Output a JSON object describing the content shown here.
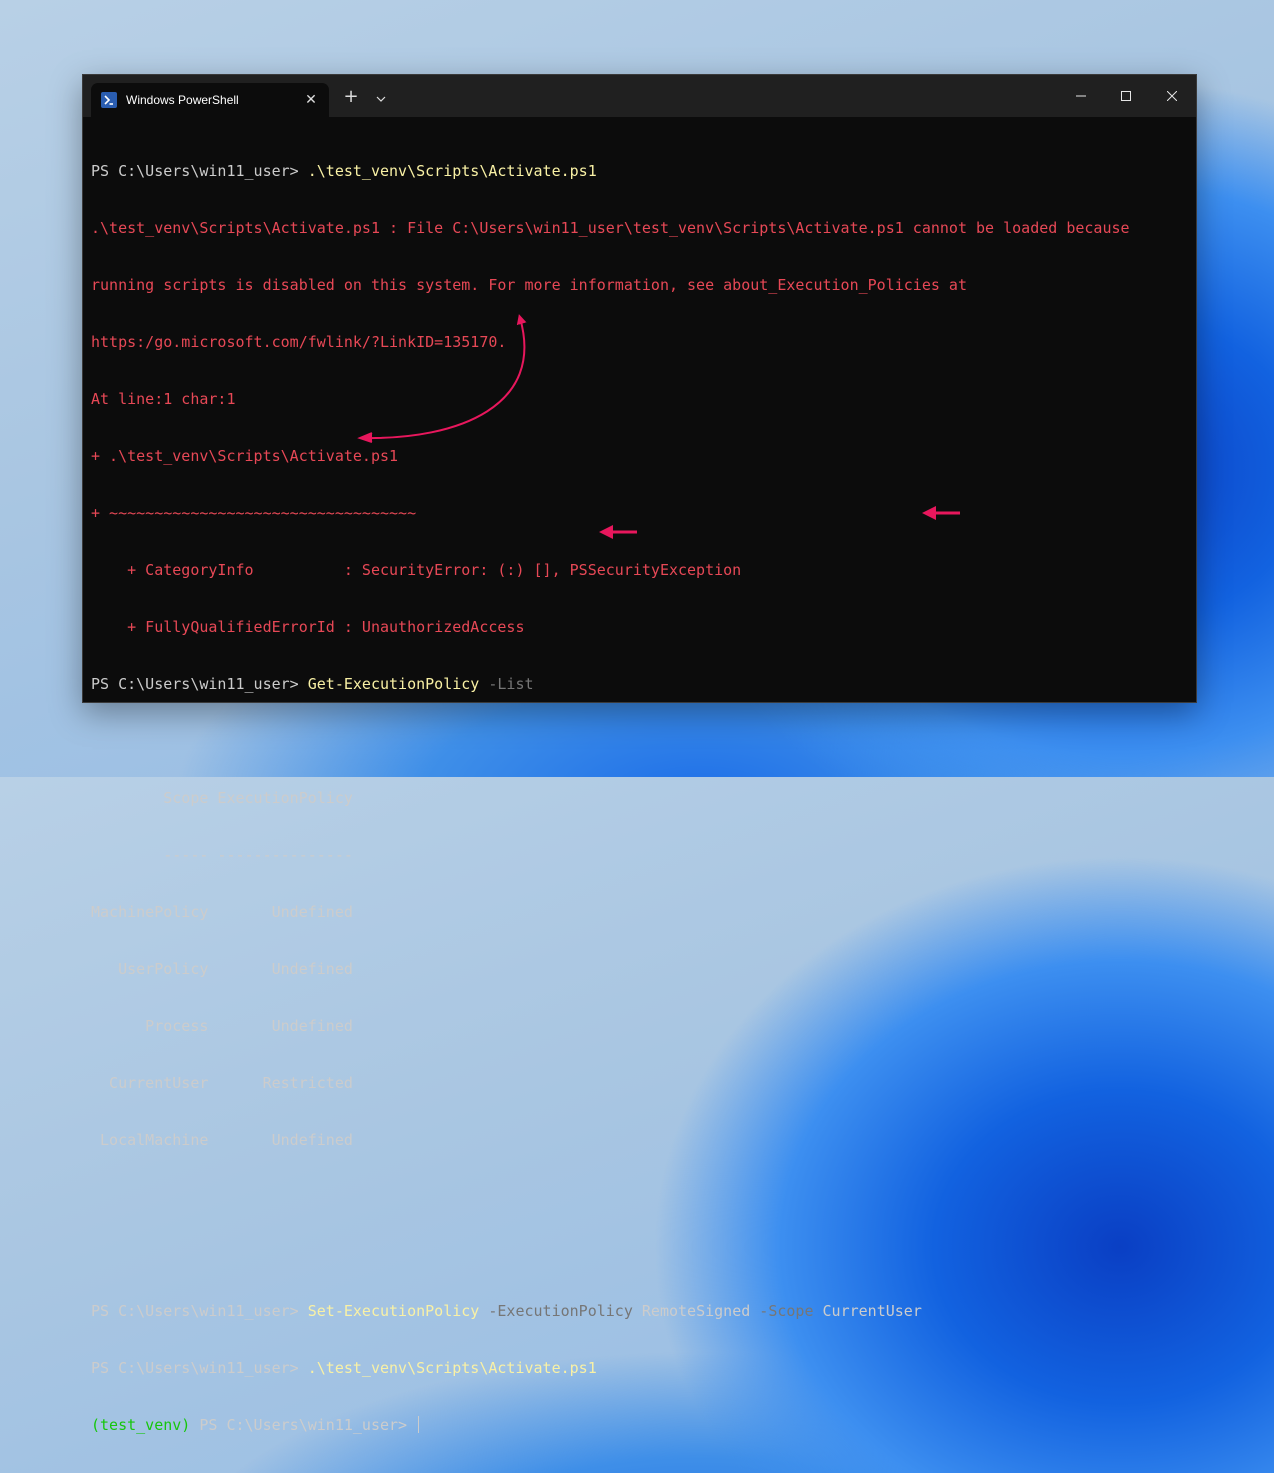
{
  "window": {
    "tab_title": "Windows PowerShell",
    "tab_close_glyph": "✕",
    "new_tab_glyph": "+",
    "dropdown_glyph": "⌄"
  },
  "terminal": {
    "prompt": "PS C:\\Users\\win11_user> ",
    "venv_prefix": "(test_venv)",
    "venv_prompt": " PS C:\\Users\\win11_user> ",
    "cmd_activate": ".\\test_venv\\Scripts\\Activate.ps1",
    "error_lines": [
      ".\\test_venv\\Scripts\\Activate.ps1 : File C:\\Users\\win11_user\\test_venv\\Scripts\\Activate.ps1 cannot be loaded because",
      "running scripts is disabled on this system. For more information, see about_Execution_Policies at",
      "https:/go.microsoft.com/fwlink/?LinkID=135170.",
      "At line:1 char:1",
      "+ .\\test_venv\\Scripts\\Activate.ps1",
      "+ ~~~~~~~~~~~~~~~~~~~~~~~~~~~~~~~~~~",
      "    + CategoryInfo          : SecurityError: (:) [], PSSecurityException",
      "    + FullyQualifiedErrorId : UnauthorizedAccess"
    ],
    "cmd_get": "Get-ExecutionPolicy",
    "cmd_get_param": " -List",
    "table_header": "        Scope ExecutionPolicy",
    "table_divider": "        ----- ---------------",
    "table_rows": [
      "MachinePolicy       Undefined",
      "   UserPolicy       Undefined",
      "      Process       Undefined",
      "  CurrentUser      Restricted",
      " LocalMachine       Undefined"
    ],
    "cmd_set": "Set-ExecutionPolicy",
    "cmd_set_param1": " -ExecutionPolicy",
    "cmd_set_value1": " RemoteSigned",
    "cmd_set_param2": " -Scope",
    "cmd_set_value2": " CurrentUser"
  },
  "colors": {
    "annotation_arrow": "#e8175d",
    "error_text": "#e74856",
    "command_text": "#f9f1a5",
    "param_text": "#767676",
    "venv_text": "#16c60c"
  }
}
